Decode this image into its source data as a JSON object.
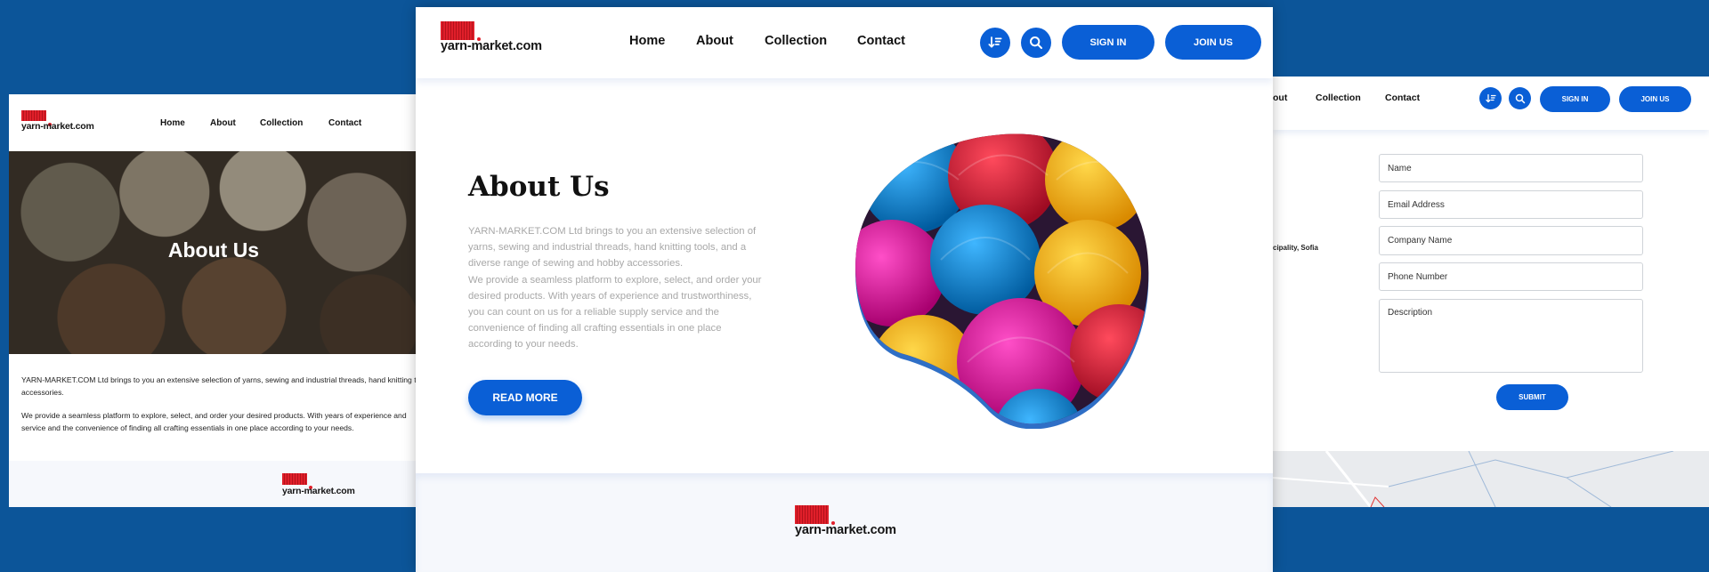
{
  "brand": {
    "logo_text": "yarn-market.com"
  },
  "nav": {
    "home": "Home",
    "about": "About",
    "collection": "Collection",
    "contact": "Contact"
  },
  "auth": {
    "sign_in": "SIGN IN",
    "join_us": "JOIN US"
  },
  "icons": {
    "sort": "sort-icon",
    "search": "search-icon"
  },
  "left_panel": {
    "hero_title": "About Us",
    "para1_line1": "YARN-MARKET.COM Ltd brings to you an extensive selection of yarns, sewing and industrial threads, hand knitting t",
    "para1_line2": "accessories.",
    "para2_line1": "We provide a seamless platform to explore, select, and order your desired products. With years of experience and",
    "para2_line2": "service and the convenience of finding all crafting essentials in one place according to your needs."
  },
  "center_panel": {
    "title": "About Us",
    "paragraph_lines": [
      "YARN-MARKET.COM Ltd brings to you an extensive selection of",
      "yarns, sewing and industrial threads, hand knitting tools, and a",
      "diverse range of sewing and hobby accessories.",
      "We provide a seamless platform to explore, select, and order your",
      "desired products. With years of experience and trustworthiness,",
      "you can count on us for a reliable supply service and the",
      "convenience of finding all crafting essentials in one place",
      "according to your needs."
    ],
    "read_more": "READ MORE"
  },
  "right_panel": {
    "nav_about_partial": "out",
    "address_partial": "cipality, Sofia",
    "form": {
      "name_placeholder": "Name",
      "email_placeholder": "Email Address",
      "company_placeholder": "Company Name",
      "phone_placeholder": "Phone Number",
      "description_placeholder": "Description",
      "submit": "SUBMIT"
    }
  },
  "colors": {
    "background": "#0c5599",
    "accent": "#0a5fd6",
    "logo_red": "#e01f2a",
    "footer": "#f6f8fc"
  }
}
